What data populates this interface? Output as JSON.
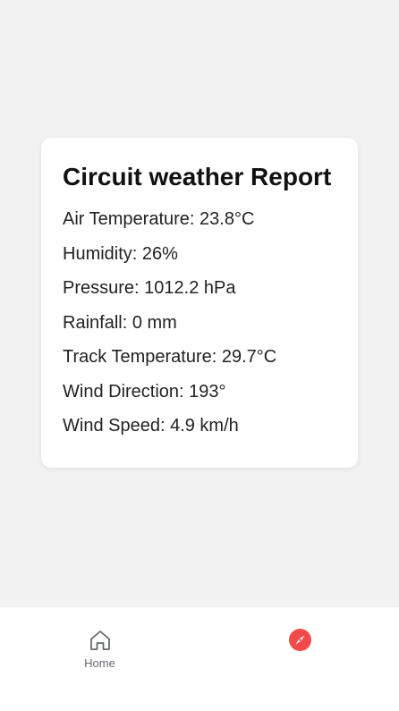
{
  "report": {
    "title": "Circuit weather Report",
    "stats": [
      "Air Temperature: 23.8°C",
      "Humidity: 26%",
      "Pressure: 1012.2 hPa",
      "Rainfall: 0 mm",
      "Track Temperature: 29.7°C",
      "Wind Direction: 193°",
      "Wind Speed: 4.9 km/h"
    ]
  },
  "tabbar": {
    "tabs": [
      {
        "label": "Home",
        "icon": "home-icon",
        "active": false
      },
      {
        "label": "",
        "icon": "compass-icon",
        "active": true
      }
    ],
    "active_color": "#f24a4a",
    "inactive_color": "#666a70"
  }
}
